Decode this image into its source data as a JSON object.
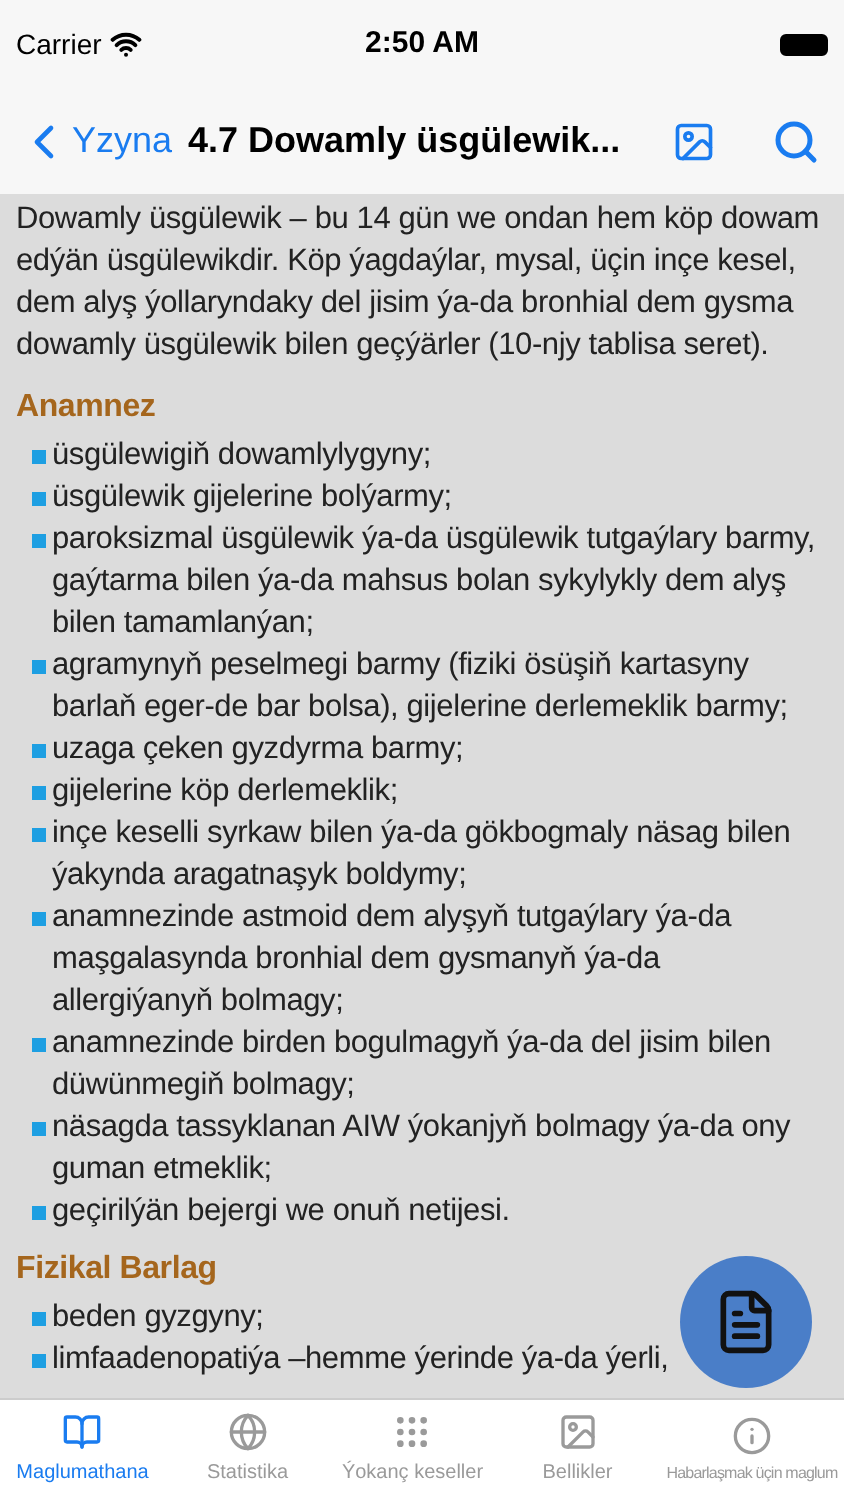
{
  "status_bar": {
    "carrier": "Carrier",
    "time": "2:50 AM"
  },
  "nav": {
    "back": "Yzyna",
    "title": "4.7 Dowamly üsgülewik..."
  },
  "intro": "Dowamly üsgülewik – bu 14 gün we ondan hem köp dowam edýän üsgülewikdir. Köp ýagdaýlar, mysal, üçin inçe kesel, dem alyş ýollaryndaky del jisim ýa-da bronhial dem gysma dowamly üsgülewik bilen geçýärler (10-njy tablisa seret).",
  "sections": [
    {
      "heading": "Anamnez",
      "items": [
        "üsgülewigiň dowamlylygyny;",
        "üsgülewik gijelerine bolýarmy;",
        "paroksizmal üsgülewik ýa-da üsgülewik tutgaýlary barmy, gaýtarma bilen ýa-da mahsus bolan sykylykly dem alyş bilen tamamlanýan;",
        "agramynyň peselmegi barmy (fiziki ösüşiň kartasyny barlaň eger-de bar bolsa), gijelerine derlemeklik barmy;",
        "uzaga çeken gyzdyrma barmy;",
        "gijelerine köp derlemeklik;",
        "inçe keselli syrkaw bilen ýa-da gökbogmaly näsag bilen ýakynda aragatnaşyk boldymy;",
        "anamnezinde astmoid dem alyşyň tutgaýlary ýa-da maşgalasynda bronhial dem gysmanyň ýa-da allergiýanyň bolmagy;",
        "anamnezinde birden bogulmagyň ýa-da del jisim bilen düwünmegiň bolmagy;",
        "näsagda tassyklanan AIW ýokanjyň bolmagy ýa-da ony guman etmeklik;",
        "geçirilýän bejergi we onuň netijesi."
      ]
    },
    {
      "heading": "Fizikal Barlag",
      "items": [
        "beden gyzgyny;",
        "limfaadenopatiýa –hemme ýerinde ýa-da ýerli,"
      ]
    }
  ],
  "tabs": [
    {
      "label": "Maglumathana",
      "selected": true
    },
    {
      "label": "Statistika",
      "selected": false
    },
    {
      "label": "Ýokanç keseller",
      "selected": false
    },
    {
      "label": "Bellikler",
      "selected": false
    },
    {
      "label": "Habarlaşmak üçin maglum",
      "selected": false
    }
  ]
}
